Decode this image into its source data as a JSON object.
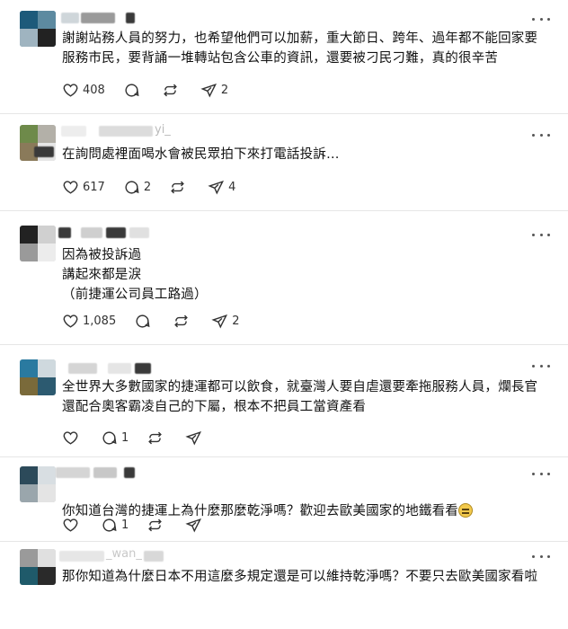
{
  "replies": [
    {
      "text": "謝謝站務人員的努力，也希望他們可以加薪，重大節日、跨年、過年都不能回家要\n服務市民，要背誦一堆轉站包含公車的資訊，還要被刁民刁難，真的很辛苦",
      "likes": "408",
      "comments": "",
      "reposts": "",
      "shares": "2"
    },
    {
      "name_partial": "yi_",
      "text": "在詢問處裡面喝水會被民眾拍下來打電話投訴…",
      "likes": "617",
      "comments": "2",
      "reposts": "",
      "shares": "4"
    },
    {
      "text": "因為被投訴過\n講起來都是淚\n（前捷運公司員工路過）",
      "likes": "1,085",
      "comments": "",
      "reposts": "",
      "shares": "2"
    },
    {
      "text": "全世界大多數國家的捷運都可以飲食，就臺灣人要自虐還要牽拖服務人員，爛長官\n還配合奧客霸凌自己的下屬，根本不把員工當資產看",
      "likes": "",
      "comments": "1",
      "reposts": "",
      "shares": ""
    },
    {
      "text": "你知道台灣的捷運上為什麼那麼乾淨嗎？歡迎去歐美國家的地鐵看看",
      "emoji": "expressionless-face-emoji",
      "likes": "",
      "comments": "1",
      "reposts": "",
      "shares": ""
    },
    {
      "name_partial": "_wan_",
      "text": "那你知道為什麼日本不用這麼多規定還是可以維持乾淨嗎？不要只去歐美國家看啦",
      "likes": "",
      "comments": "",
      "reposts": "",
      "shares": ""
    }
  ],
  "icons": {
    "like": "heart-icon",
    "comment": "comment-bubble-icon",
    "repost": "repost-arrows-icon",
    "share": "send-paper-plane-icon",
    "more": "more-dots-icon"
  }
}
